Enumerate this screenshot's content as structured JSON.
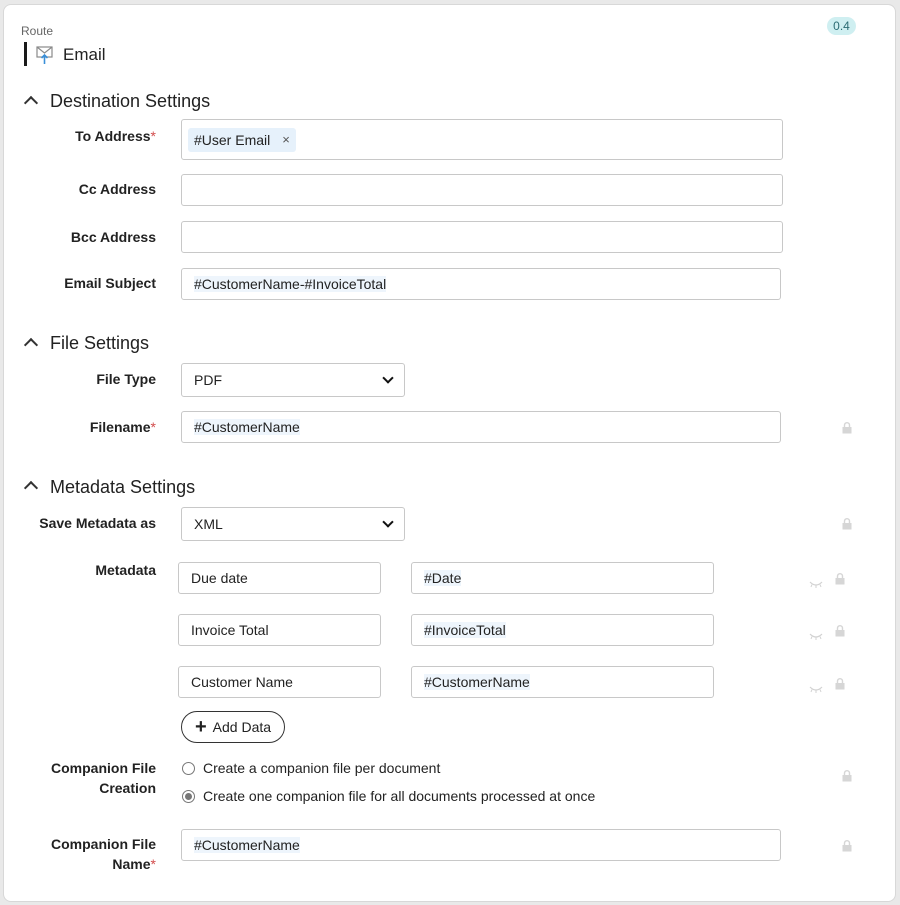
{
  "header": {
    "route_label": "Route",
    "route_name": "Email",
    "route_icon": "email-send-icon",
    "version": "0.4"
  },
  "destination": {
    "title": "Destination Settings",
    "to_label": "To Address",
    "to_chip": "#User Email",
    "to_chip_remove": "×",
    "cc_label": "Cc Address",
    "cc_value": "",
    "bcc_label": "Bcc Address",
    "bcc_value": "",
    "subject_label": "Email Subject",
    "subject_value": "#CustomerName-#InvoiceTotal"
  },
  "file": {
    "title": "File Settings",
    "type_label": "File Type",
    "type_value": "PDF",
    "filename_label": "Filename",
    "filename_value": "#CustomerName"
  },
  "metadata": {
    "title": "Metadata Settings",
    "save_as_label": "Save Metadata as",
    "save_as_value": "XML",
    "metadata_label": "Metadata",
    "rows": [
      {
        "key": "Due date",
        "value": "#Date"
      },
      {
        "key": "Invoice Total",
        "value": "#InvoiceTotal"
      },
      {
        "key": "Customer Name",
        "value": "#CustomerName"
      }
    ],
    "add_button": "Add Data",
    "companion_label_1": "Companion File",
    "companion_label_2": "Creation",
    "companion_options": [
      "Create a companion file per document",
      "Create one companion file for all documents processed at once"
    ],
    "companion_selected": 1,
    "companion_name_label_1": "Companion File",
    "companion_name_label_2": "Name",
    "companion_name_value": "#CustomerName"
  },
  "required_marker": "*"
}
